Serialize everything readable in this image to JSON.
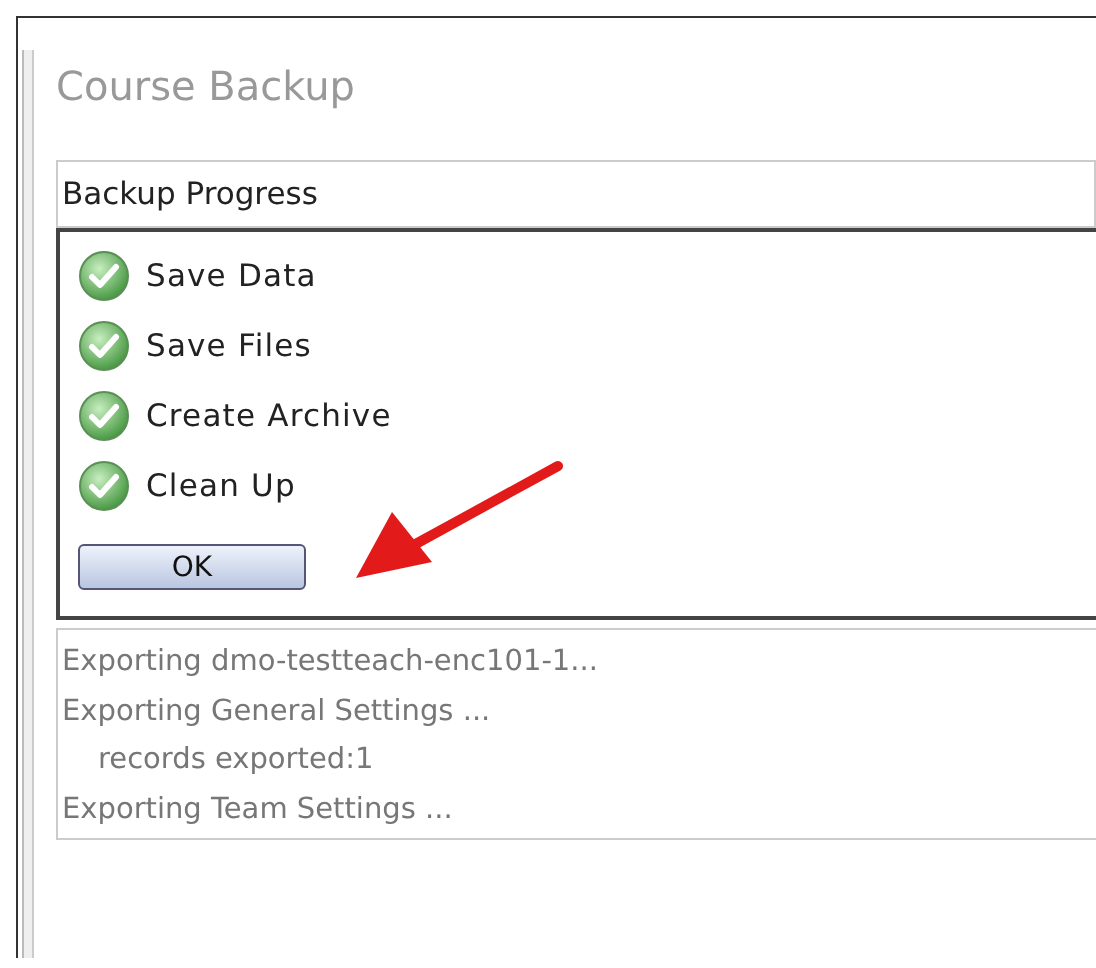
{
  "title": "Course Backup",
  "progress": {
    "heading": "Backup Progress",
    "steps": [
      {
        "label": "Save Data",
        "done": true
      },
      {
        "label": "Save Files",
        "done": true
      },
      {
        "label": "Create Archive",
        "done": true
      },
      {
        "label": "Clean Up",
        "done": true
      }
    ],
    "button": "OK"
  },
  "log": [
    {
      "text": "Exporting dmo-testteach-enc101-1...",
      "indent": false
    },
    {
      "text": "Exporting General Settings ...",
      "indent": false
    },
    {
      "text": "records exported:1",
      "indent": true
    },
    {
      "text": "Exporting Team Settings ...",
      "indent": false
    }
  ]
}
